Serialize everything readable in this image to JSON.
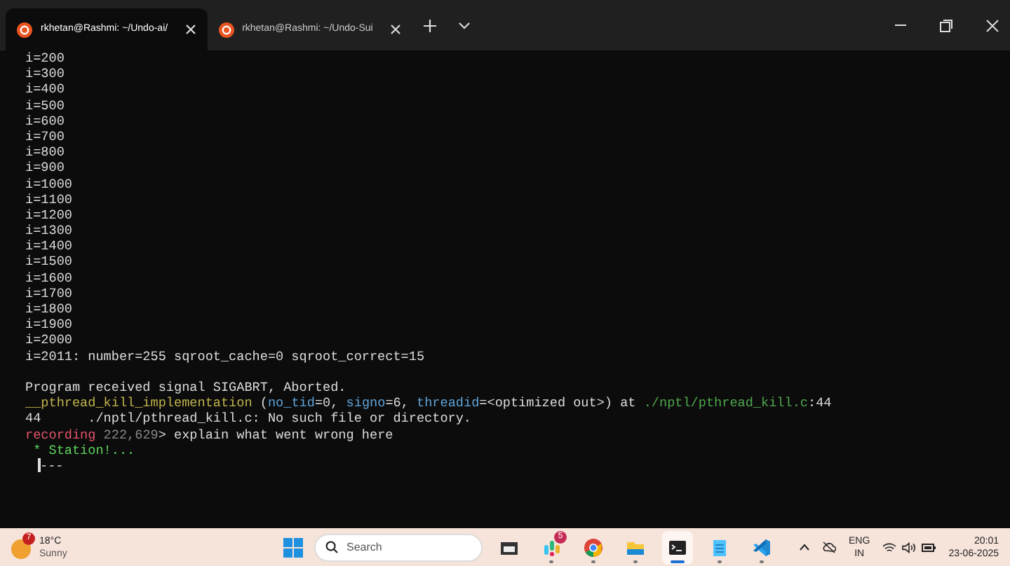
{
  "window": {
    "tabs": [
      {
        "title": "rkhetan@Rashmi: ~/Undo-ai/",
        "selected": true
      },
      {
        "title": "rkhetan@Rashmi: ~/Undo-Sui",
        "selected": false
      }
    ]
  },
  "terminal": {
    "lines": [
      {
        "segments": [
          {
            "kind": "plain",
            "text": "i=200"
          }
        ]
      },
      {
        "segments": [
          {
            "kind": "plain",
            "text": "i=300"
          }
        ]
      },
      {
        "segments": [
          {
            "kind": "plain",
            "text": "i=400"
          }
        ]
      },
      {
        "segments": [
          {
            "kind": "plain",
            "text": "i=500"
          }
        ]
      },
      {
        "segments": [
          {
            "kind": "plain",
            "text": "i=600"
          }
        ]
      },
      {
        "segments": [
          {
            "kind": "plain",
            "text": "i=700"
          }
        ]
      },
      {
        "segments": [
          {
            "kind": "plain",
            "text": "i=800"
          }
        ]
      },
      {
        "segments": [
          {
            "kind": "plain",
            "text": "i=900"
          }
        ]
      },
      {
        "segments": [
          {
            "kind": "plain",
            "text": "i=1000"
          }
        ]
      },
      {
        "segments": [
          {
            "kind": "plain",
            "text": "i=1100"
          }
        ]
      },
      {
        "segments": [
          {
            "kind": "plain",
            "text": "i=1200"
          }
        ]
      },
      {
        "segments": [
          {
            "kind": "plain",
            "text": "i=1300"
          }
        ]
      },
      {
        "segments": [
          {
            "kind": "plain",
            "text": "i=1400"
          }
        ]
      },
      {
        "segments": [
          {
            "kind": "plain",
            "text": "i=1500"
          }
        ]
      },
      {
        "segments": [
          {
            "kind": "plain",
            "text": "i=1600"
          }
        ]
      },
      {
        "segments": [
          {
            "kind": "plain",
            "text": "i=1700"
          }
        ]
      },
      {
        "segments": [
          {
            "kind": "plain",
            "text": "i=1800"
          }
        ]
      },
      {
        "segments": [
          {
            "kind": "plain",
            "text": "i=1900"
          }
        ]
      },
      {
        "segments": [
          {
            "kind": "plain",
            "text": "i=2000"
          }
        ]
      },
      {
        "segments": [
          {
            "kind": "plain",
            "text": "i=2011: number=255 sqroot_cache=0 sqroot_correct=15"
          }
        ]
      },
      {
        "blank_before": true,
        "segments": [
          {
            "kind": "plain",
            "text": "Program received signal SIGABRT, Aborted."
          }
        ]
      },
      {
        "segments": [
          {
            "kind": "function",
            "text": "__pthread_kill_implementation"
          },
          {
            "kind": "plain",
            "text": " ("
          },
          {
            "kind": "param",
            "text": "no_tid"
          },
          {
            "kind": "plain",
            "text": "=0, "
          },
          {
            "kind": "param",
            "text": "signo"
          },
          {
            "kind": "plain",
            "text": "=6, "
          },
          {
            "kind": "param",
            "text": "threadid"
          },
          {
            "kind": "plain",
            "text": "=<optimized out>) at "
          },
          {
            "kind": "path",
            "text": "./nptl/pthread_kill.c"
          },
          {
            "kind": "plain",
            "text": ":44"
          }
        ]
      },
      {
        "segments": [
          {
            "kind": "plain",
            "text": "44      ./nptl/pthread_kill.c: No such file or directory."
          }
        ]
      },
      {
        "segments": [
          {
            "kind": "prompt",
            "text": "recording"
          },
          {
            "kind": "counter",
            "text": "222,629"
          },
          {
            "kind": "plain",
            "text": "> explain what went wrong here"
          }
        ]
      },
      {
        "segments": [
          {
            "kind": "status",
            "text": " * Station!..."
          }
        ]
      },
      {
        "segments": [
          {
            "kind": "cursor"
          },
          {
            "kind": "plain",
            "text": "---"
          }
        ]
      }
    ]
  },
  "taskbar": {
    "weather": {
      "badge": "7",
      "temperature": "18°C",
      "condition": "Sunny"
    },
    "search": {
      "placeholder": "Search"
    },
    "apps": [
      {
        "kind": "files-dark",
        "active": false,
        "running": false
      },
      {
        "kind": "chat",
        "active": false,
        "running": true,
        "badge": "5"
      },
      {
        "kind": "browser",
        "active": false,
        "running": true
      },
      {
        "kind": "folder",
        "active": false,
        "running": true
      },
      {
        "kind": "terminal",
        "active": true,
        "running": true
      },
      {
        "kind": "notepad",
        "active": false,
        "running": true
      },
      {
        "kind": "editor",
        "active": false,
        "running": true
      }
    ],
    "tray": {
      "language": "ENG",
      "region": "IN",
      "time": "20:01",
      "date": "23-06-2025"
    }
  }
}
